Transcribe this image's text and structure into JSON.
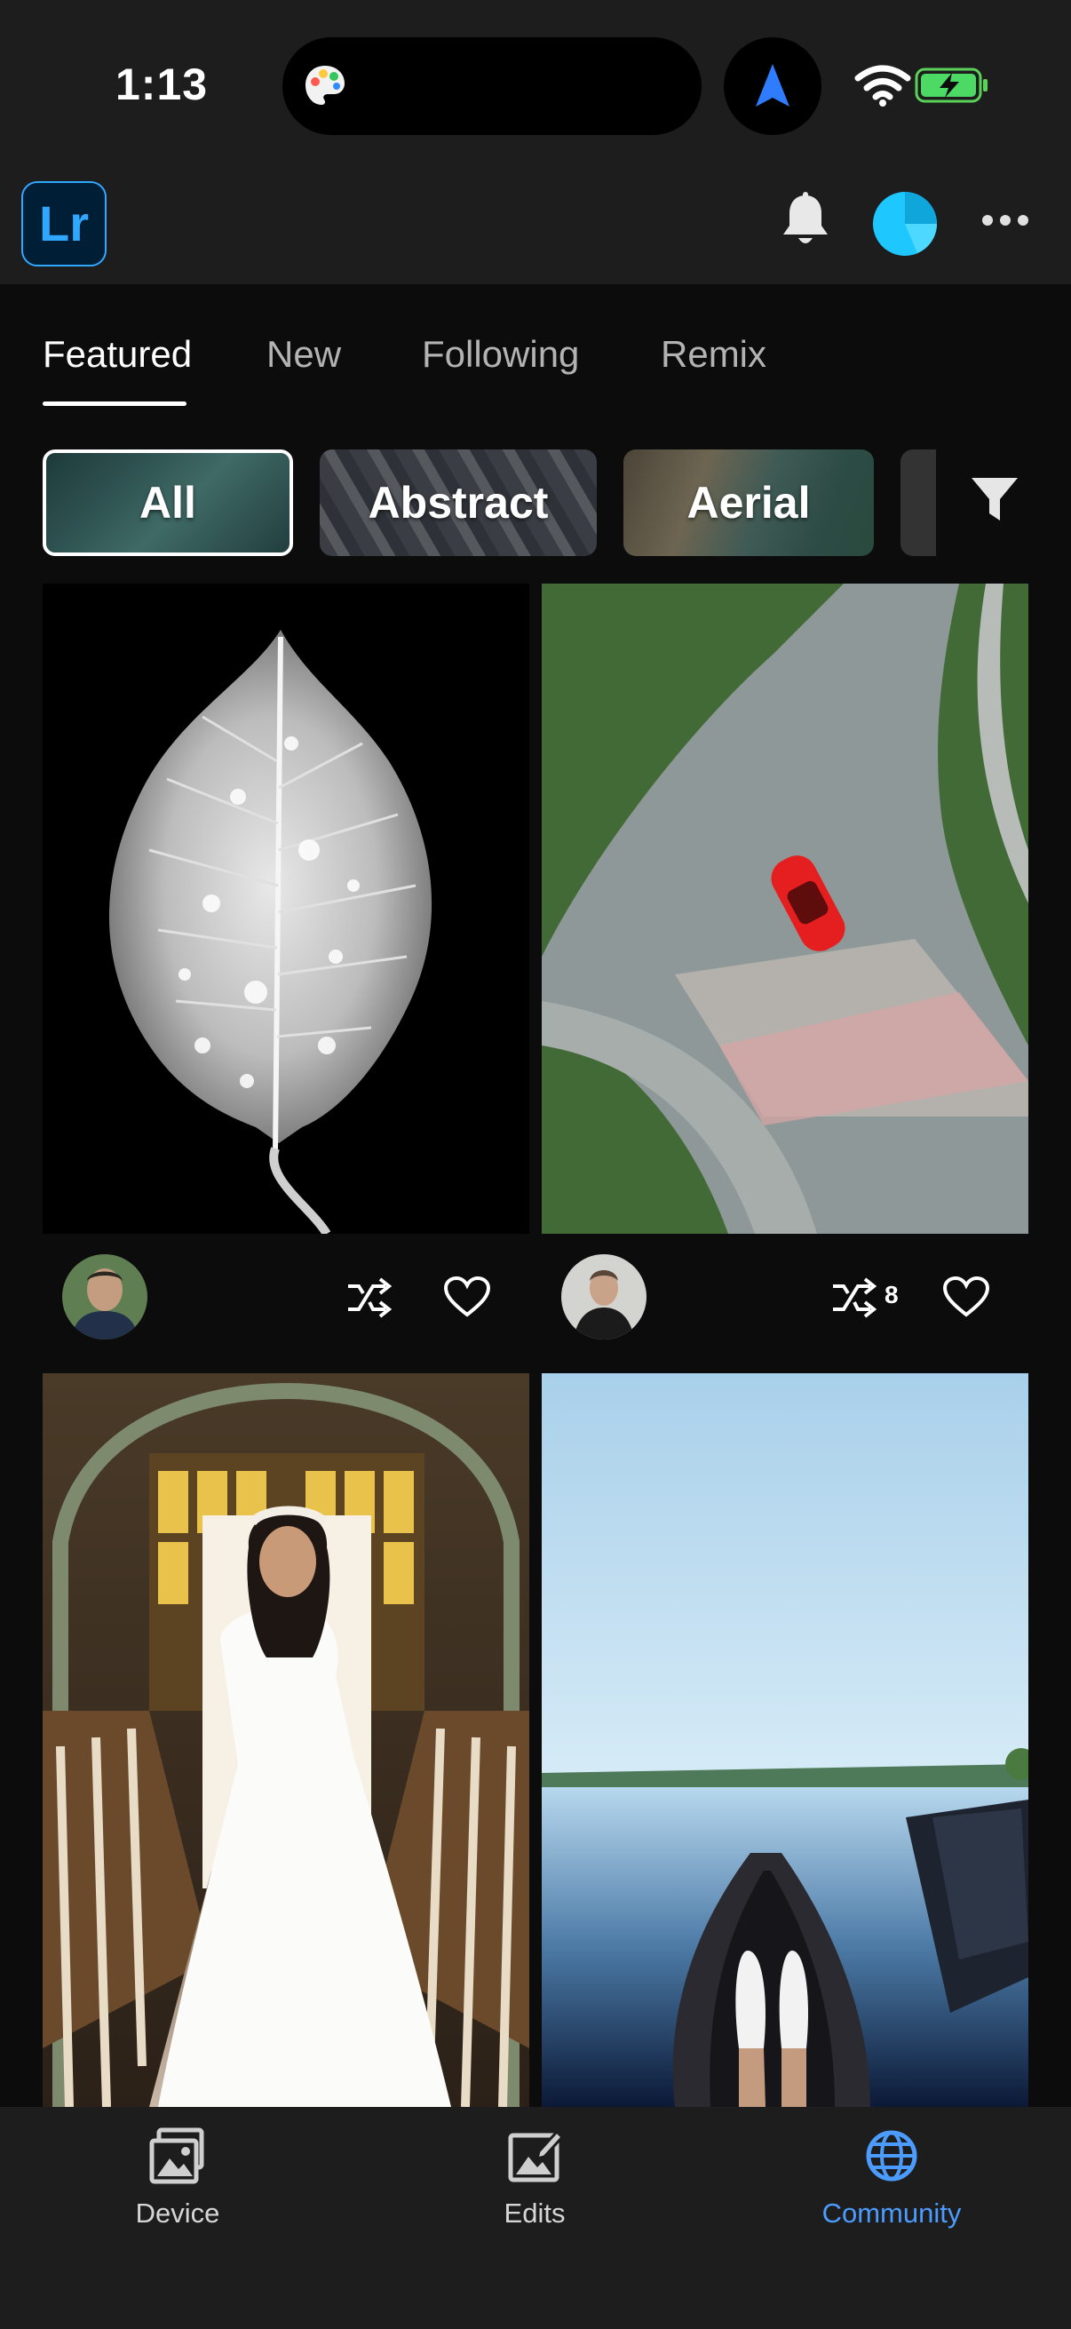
{
  "status_bar": {
    "time": "1:13"
  },
  "app": {
    "logo_text": "Lr"
  },
  "tabs": [
    {
      "label": "Featured",
      "active": true
    },
    {
      "label": "New"
    },
    {
      "label": "Following"
    },
    {
      "label": "Remix"
    }
  ],
  "categories": [
    {
      "label": "All",
      "selected": true
    },
    {
      "label": "Abstract"
    },
    {
      "label": "Aerial"
    }
  ],
  "feed": [
    {
      "subject": "leaf",
      "remix_count": ""
    },
    {
      "subject": "red car on road",
      "remix_count": "8"
    },
    {
      "subject": "girl in white dress"
    },
    {
      "subject": "boat on lake"
    }
  ],
  "bottom_nav": [
    {
      "label": "Device",
      "icon": "photos-icon"
    },
    {
      "label": "Edits",
      "icon": "edit-photo-icon"
    },
    {
      "label": "Community",
      "icon": "globe-icon",
      "active": true
    }
  ],
  "colors": {
    "accent": "#4c9bff",
    "brand": "#31a8ff",
    "background": "#0c0c0c"
  }
}
